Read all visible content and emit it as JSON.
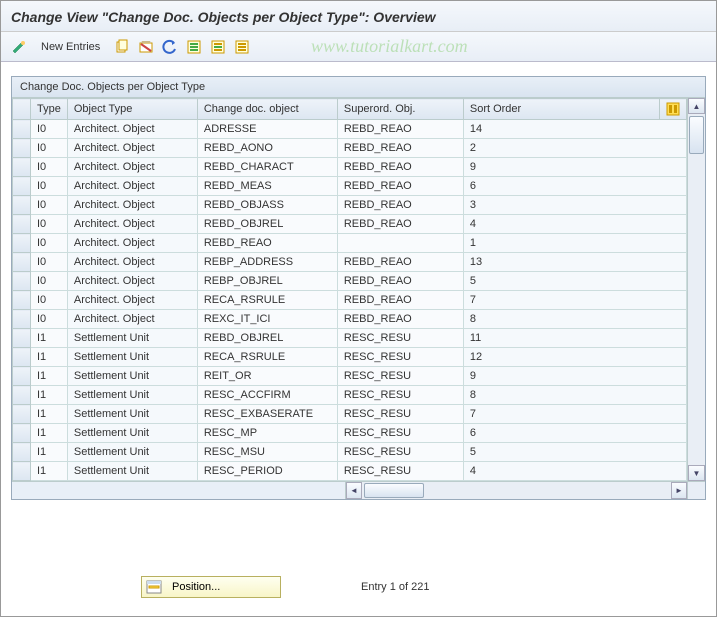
{
  "title": "Change View \"Change Doc. Objects per Object Type\": Overview",
  "toolbar": {
    "new_entries": "New Entries"
  },
  "watermark": "www.tutorialkart.com",
  "panel": {
    "header": "Change Doc. Objects per Object Type",
    "columns": {
      "type": "Type",
      "object_type": "Object Type",
      "change_doc_object": "Change doc. object",
      "superord_obj": "Superord. Obj.",
      "sort_order": "Sort Order"
    },
    "rows": [
      {
        "type": "I0",
        "otype": "Architect. Object",
        "cdo": "ADRESSE",
        "sup": "REBD_REAO",
        "sort": "14"
      },
      {
        "type": "I0",
        "otype": "Architect. Object",
        "cdo": "REBD_AONO",
        "sup": "REBD_REAO",
        "sort": "2"
      },
      {
        "type": "I0",
        "otype": "Architect. Object",
        "cdo": "REBD_CHARACT",
        "sup": "REBD_REAO",
        "sort": "9"
      },
      {
        "type": "I0",
        "otype": "Architect. Object",
        "cdo": "REBD_MEAS",
        "sup": "REBD_REAO",
        "sort": "6"
      },
      {
        "type": "I0",
        "otype": "Architect. Object",
        "cdo": "REBD_OBJASS",
        "sup": "REBD_REAO",
        "sort": "3"
      },
      {
        "type": "I0",
        "otype": "Architect. Object",
        "cdo": "REBD_OBJREL",
        "sup": "REBD_REAO",
        "sort": "4"
      },
      {
        "type": "I0",
        "otype": "Architect. Object",
        "cdo": "REBD_REAO",
        "sup": "",
        "sort": "1"
      },
      {
        "type": "I0",
        "otype": "Architect. Object",
        "cdo": "REBP_ADDRESS",
        "sup": "REBD_REAO",
        "sort": "13"
      },
      {
        "type": "I0",
        "otype": "Architect. Object",
        "cdo": "REBP_OBJREL",
        "sup": "REBD_REAO",
        "sort": "5"
      },
      {
        "type": "I0",
        "otype": "Architect. Object",
        "cdo": "RECA_RSRULE",
        "sup": "REBD_REAO",
        "sort": "7"
      },
      {
        "type": "I0",
        "otype": "Architect. Object",
        "cdo": "REXC_IT_ICI",
        "sup": "REBD_REAO",
        "sort": "8"
      },
      {
        "type": "I1",
        "otype": "Settlement Unit",
        "cdo": "REBD_OBJREL",
        "sup": "RESC_RESU",
        "sort": "11"
      },
      {
        "type": "I1",
        "otype": "Settlement Unit",
        "cdo": "RECA_RSRULE",
        "sup": "RESC_RESU",
        "sort": "12"
      },
      {
        "type": "I1",
        "otype": "Settlement Unit",
        "cdo": "REIT_OR",
        "sup": "RESC_RESU",
        "sort": "9"
      },
      {
        "type": "I1",
        "otype": "Settlement Unit",
        "cdo": "RESC_ACCFIRM",
        "sup": "RESC_RESU",
        "sort": "8"
      },
      {
        "type": "I1",
        "otype": "Settlement Unit",
        "cdo": "RESC_EXBASERATE",
        "sup": "RESC_RESU",
        "sort": "7"
      },
      {
        "type": "I1",
        "otype": "Settlement Unit",
        "cdo": "RESC_MP",
        "sup": "RESC_RESU",
        "sort": "6"
      },
      {
        "type": "I1",
        "otype": "Settlement Unit",
        "cdo": "RESC_MSU",
        "sup": "RESC_RESU",
        "sort": "5"
      },
      {
        "type": "I1",
        "otype": "Settlement Unit",
        "cdo": "RESC_PERIOD",
        "sup": "RESC_RESU",
        "sort": "4"
      }
    ]
  },
  "footer": {
    "position_label": "Position...",
    "entry_text": "Entry 1 of 221"
  }
}
